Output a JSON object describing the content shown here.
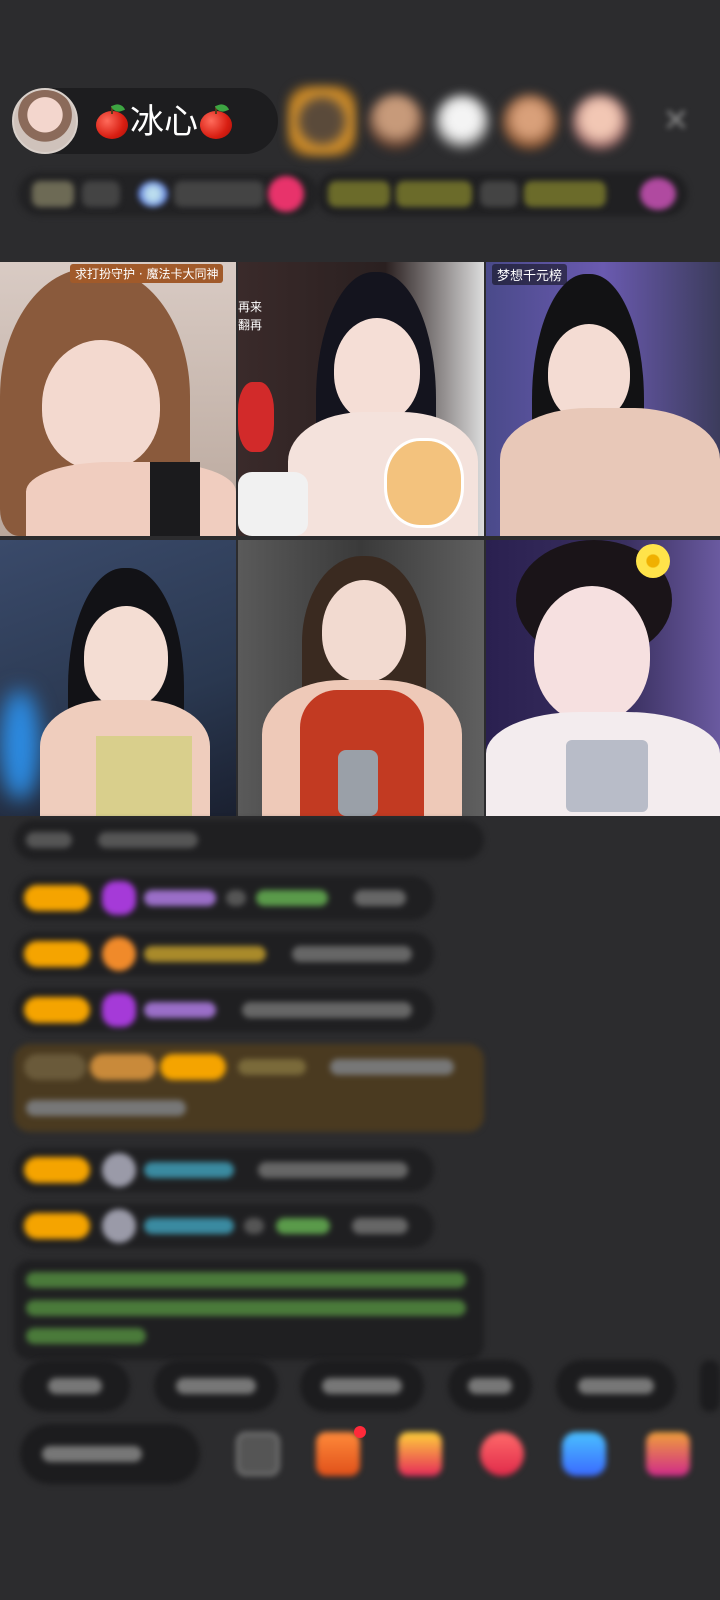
{
  "host": {
    "name": "冰心",
    "avatar": "host-avatar"
  },
  "grid": {
    "tiles": [
      {
        "id": "tile-1",
        "label": "求打扮守护 · 魔法卡大同神"
      },
      {
        "id": "tile-2",
        "side_text": [
          "再来",
          "翻再"
        ]
      },
      {
        "id": "tile-3",
        "label": "梦想千元榜"
      },
      {
        "id": "tile-4"
      },
      {
        "id": "tile-5"
      },
      {
        "id": "tile-6"
      }
    ]
  },
  "bottom": {
    "quick_chips": 6,
    "tools": [
      "box-icon",
      "gift-box-icon",
      "treasure-icon",
      "heart-gift-icon",
      "game-icon",
      "more-gift-icon"
    ]
  },
  "colors": {
    "background": "#2c2c2e",
    "chat_bubble": "#1f1f21",
    "level_badge": "#f5a400",
    "highlight_row": "#4a3a20",
    "system_text": "#8fd46b"
  }
}
